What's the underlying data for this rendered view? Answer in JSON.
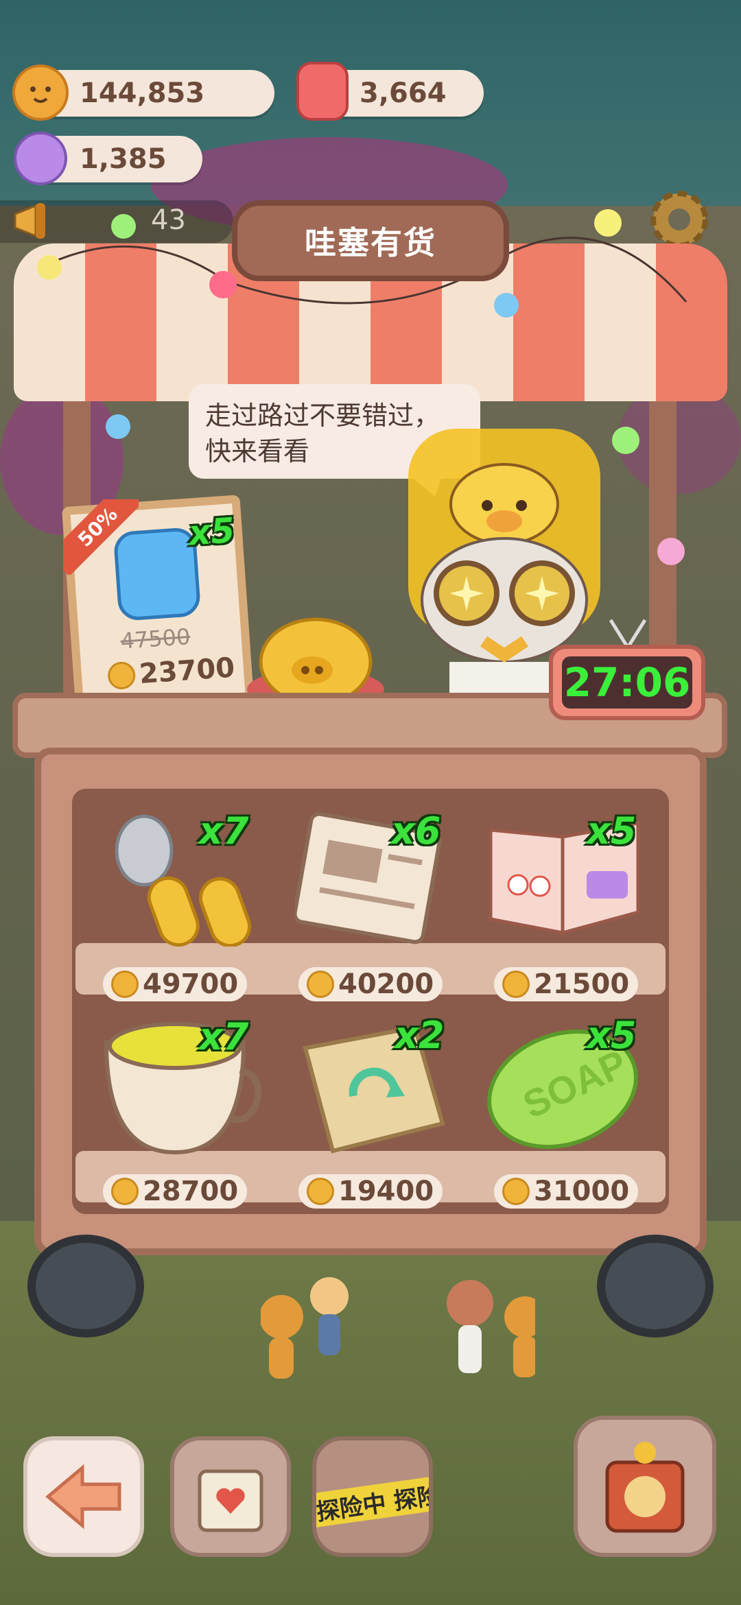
{
  "resources": {
    "cookies": "144,853",
    "gems": "3,664",
    "candy": "1,385"
  },
  "notification_count": "43",
  "shop": {
    "title": "哇塞有货",
    "speech": "走过路过不要错过，快来看看",
    "timer": "27:06",
    "featured": {
      "discount": "50%",
      "quantity": "x5",
      "old_price": "47500",
      "price": "23700"
    },
    "items": [
      {
        "quantity": "x7",
        "price": "49700",
        "icon": "spoon-fork-icon"
      },
      {
        "quantity": "x6",
        "price": "40200",
        "icon": "newspaper-icon"
      },
      {
        "quantity": "x5",
        "price": "21500",
        "icon": "magazine-icon"
      },
      {
        "quantity": "x7",
        "price": "28700",
        "icon": "tea-cup-icon"
      },
      {
        "quantity": "x2",
        "price": "19400",
        "icon": "paper-bag-icon"
      },
      {
        "quantity": "x5",
        "price": "31000",
        "icon": "soap-icon"
      }
    ],
    "soap_text": "SOAP"
  },
  "bottom_bar": {
    "tape_text": "探险中 探险"
  },
  "colors": {
    "quantity_green": "#3ce23c",
    "timer_green": "#3bf03b",
    "awning_red": "#ef7e69",
    "wood": "#a06e58"
  }
}
